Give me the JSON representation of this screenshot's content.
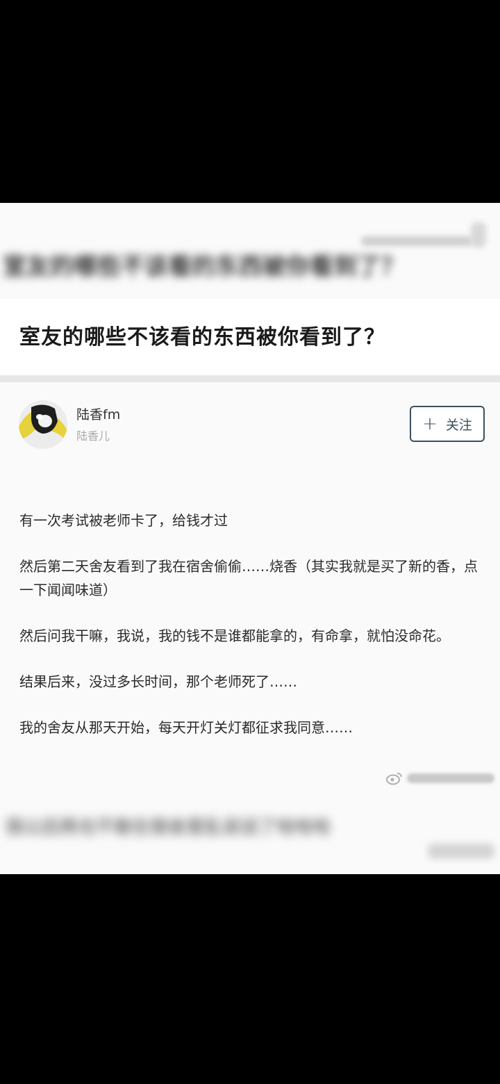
{
  "header": {
    "blurred_title": "室友的哪些不该看的东西被你看到了？"
  },
  "question": {
    "title": "室友的哪些不该看的东西被你看到了？"
  },
  "author": {
    "name": "陆香fm",
    "subtitle": "陆香儿",
    "follow_label": "关注",
    "follow_icon": "plus-icon"
  },
  "answer": {
    "paragraphs": [
      "有一次考试被老师卡了，给钱才过",
      "然后第二天舍友看到了我在宿舍偷偷……烧香（其实我就是买了新的香，点一下闻闻味道）",
      "然后问我干嘛，我说，我的钱不是谁都能拿的，有命拿，就怕没命花。",
      "结果后来，没过多长时间，那个老师死了……",
      "我的舍友从那天开始，每天开灯关灯都征求我同意……"
    ]
  },
  "footer": {
    "blurred_text": "我以后再也不敢在宿舍里乱说话了哈哈哈"
  },
  "watermark": {
    "icon": "weibo-icon"
  }
}
